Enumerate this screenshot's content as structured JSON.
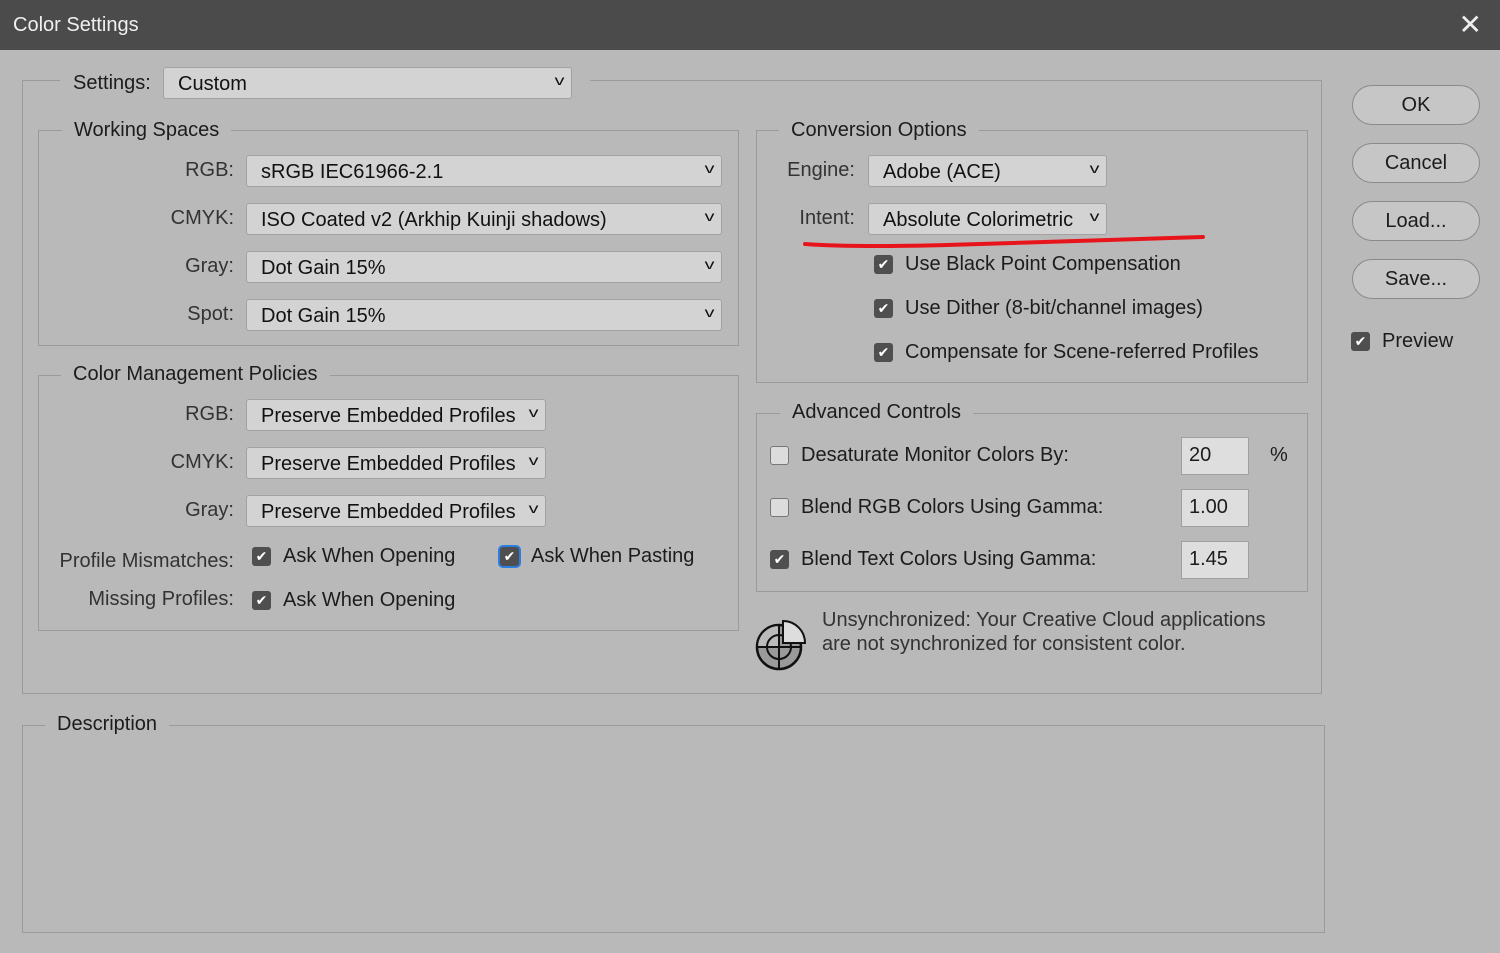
{
  "title": "Color Settings",
  "settings": {
    "label": "Settings:",
    "value": "Custom"
  },
  "working_spaces": {
    "title": "Working Spaces",
    "rows": [
      {
        "label": "RGB:",
        "value": "sRGB IEC61966-2.1"
      },
      {
        "label": "CMYK:",
        "value": "ISO Coated v2 (Arkhip Kuinji shadows)"
      },
      {
        "label": "Gray:",
        "value": "Dot Gain 15%"
      },
      {
        "label": "Spot:",
        "value": "Dot Gain 15%"
      }
    ]
  },
  "policies": {
    "title": "Color Management Policies",
    "rows": [
      {
        "label": "RGB:",
        "value": "Preserve Embedded Profiles"
      },
      {
        "label": "CMYK:",
        "value": "Preserve Embedded Profiles"
      },
      {
        "label": "Gray:",
        "value": "Preserve Embedded Profiles"
      }
    ],
    "mismatch_label": "Profile Mismatches:",
    "ask_opening": "Ask When Opening",
    "ask_pasting": "Ask When Pasting",
    "missing_label": "Missing Profiles:",
    "missing_ask_opening": "Ask When Opening"
  },
  "conversion": {
    "title": "Conversion Options",
    "engine_label": "Engine:",
    "engine": "Adobe (ACE)",
    "intent_label": "Intent:",
    "intent": "Absolute Colorimetric",
    "options": [
      "Use Black Point Compensation",
      "Use Dither (8-bit/channel images)",
      "Compensate for Scene-referred Profiles"
    ]
  },
  "advanced": {
    "title": "Advanced Controls",
    "rows": [
      {
        "label": "Desaturate Monitor Colors By:",
        "value": "20",
        "unit": "%",
        "checked": false
      },
      {
        "label": "Blend RGB Colors Using Gamma:",
        "value": "1.00",
        "checked": false
      },
      {
        "label": "Blend Text Colors Using Gamma:",
        "value": "1.45",
        "checked": true
      }
    ]
  },
  "sync": {
    "line1": "Unsynchronized: Your Creative Cloud applications",
    "line2": "are not synchronized for consistent color."
  },
  "description": {
    "title": "Description"
  },
  "buttons": {
    "ok": "OK",
    "cancel": "Cancel",
    "load": "Load...",
    "save": "Save...",
    "preview": "Preview"
  },
  "annotation_color": "#e8141c"
}
